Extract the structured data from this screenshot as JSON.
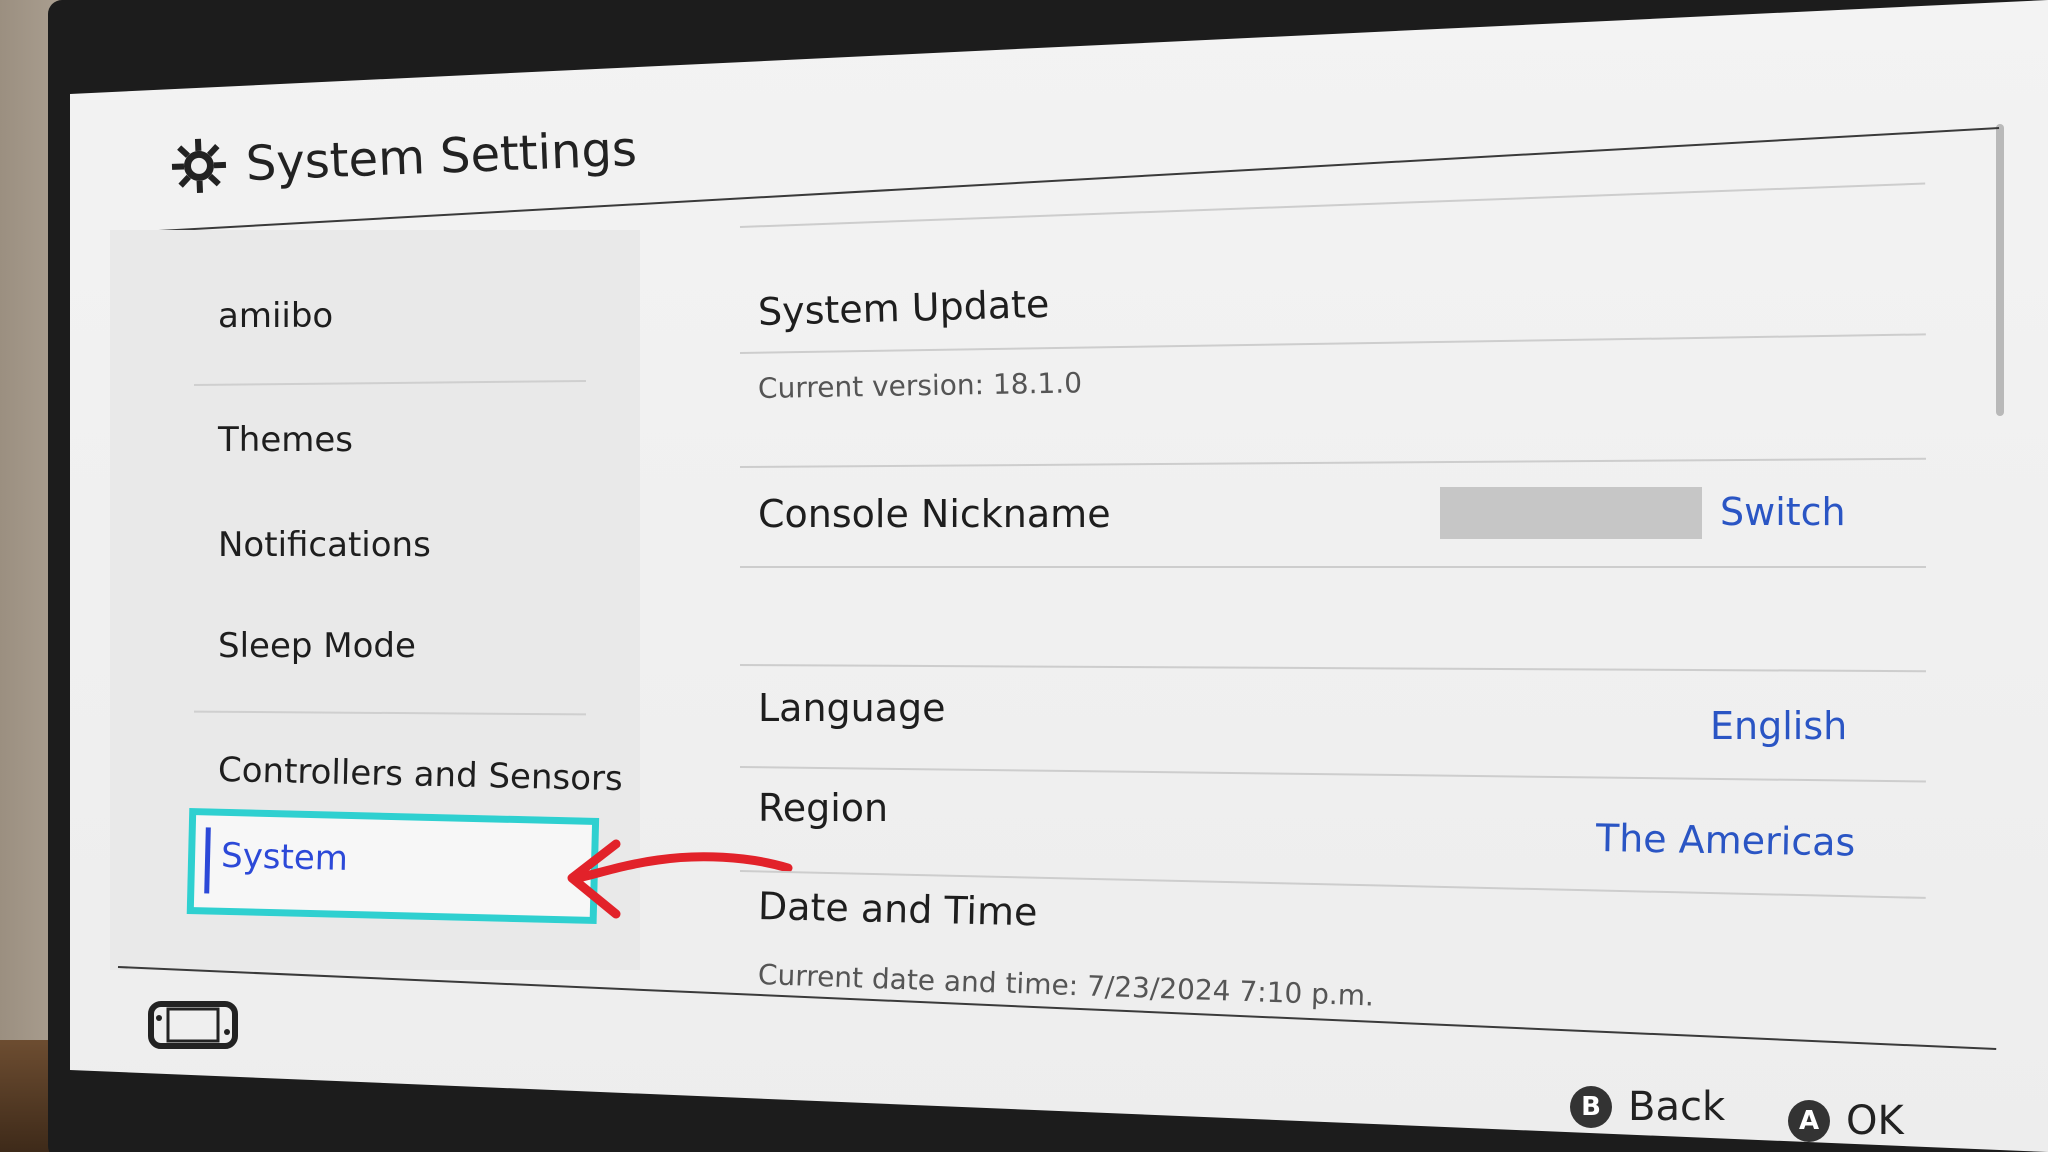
{
  "header": {
    "title": "System Settings",
    "icon": "gear-icon"
  },
  "sidebar": {
    "items": [
      {
        "label": "amiibo"
      },
      {
        "label": "Themes"
      },
      {
        "label": "Notifications"
      },
      {
        "label": "Sleep Mode"
      },
      {
        "label": "Controllers and Sensors"
      },
      {
        "label": "System",
        "selected": true
      }
    ],
    "accent": "#2c49d8",
    "highlight_color": "#2fd0d0"
  },
  "main": {
    "system_update": {
      "title": "System Update",
      "sub": "Current version: 18.1.0"
    },
    "console_nickname": {
      "title": "Console Nickname",
      "value": "Switch"
    },
    "language": {
      "title": "Language",
      "value": "English"
    },
    "region": {
      "title": "Region",
      "value": "The Americas"
    },
    "date_time": {
      "title": "Date and Time",
      "sub": "Current date and time: 7/23/2024 7:10 p.m."
    }
  },
  "footer": {
    "back": {
      "button": "B",
      "label": "Back"
    },
    "ok": {
      "button": "A",
      "label": "OK"
    },
    "icon": "handheld-console-icon"
  },
  "annotation": {
    "icon": "red-arrow-icon",
    "color": "#e2222a"
  }
}
